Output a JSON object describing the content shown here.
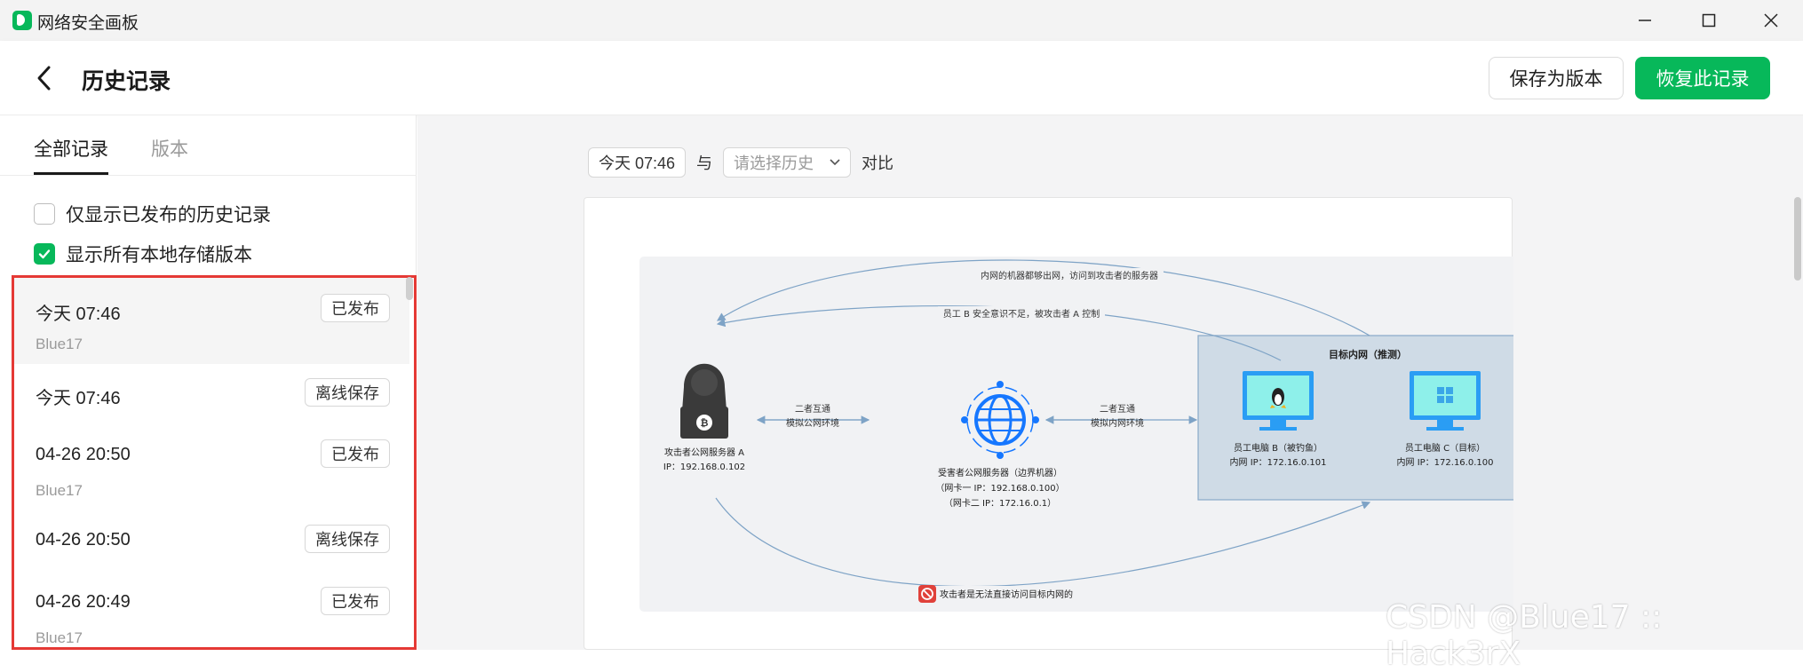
{
  "window": {
    "title": "网络安全画板"
  },
  "header": {
    "title": "历史记录",
    "save_version_label": "保存为版本",
    "restore_label": "恢复此记录"
  },
  "sidebar": {
    "tabs": [
      {
        "label": "全部记录"
      },
      {
        "label": "版本"
      }
    ],
    "filters": [
      {
        "label": "仅显示已发布的历史记录",
        "checked": false
      },
      {
        "label": "显示所有本地存储版本",
        "checked": true
      }
    ],
    "items": [
      {
        "time": "今天 07:46",
        "badge": "已发布",
        "user": "Blue17",
        "selected": true
      },
      {
        "time": "今天 07:46",
        "badge": "离线保存",
        "user": ""
      },
      {
        "time": "04-26 20:50",
        "badge": "已发布",
        "user": "Blue17"
      },
      {
        "time": "04-26 20:50",
        "badge": "离线保存",
        "user": ""
      },
      {
        "time": "04-26 20:49",
        "badge": "已发布",
        "user": "Blue17"
      }
    ]
  },
  "compare": {
    "current": "今天 07:46",
    "with_label": "与",
    "select_placeholder": "请选择历史",
    "action": "对比"
  },
  "diagram": {
    "top_label": "内网的机器都够出网，访问到攻击者的服务器",
    "second_label": "员工 B 安全意识不足，被攻击者 A 控制",
    "target_title": "目标内网（推测）",
    "link1_a": "二者互通",
    "link1_b": "模拟公网环境",
    "link2_a": "二者互通",
    "link2_b": "模拟内网环境",
    "attacker_name": "攻击者公网服务器 A",
    "attacker_ip": "IP：192.168.0.102",
    "victim_name": "受害者公网服务器（边界机器）",
    "victim_nic1": "（网卡一 IP：192.168.0.100）",
    "victim_nic2": "（网卡二 IP：172.16.0.1）",
    "pc_b_name": "员工电脑 B（被钓鱼）",
    "pc_b_ip": "内网 IP：172.16.0.101",
    "pc_c_name": "员工电脑 C（目标）",
    "pc_c_ip": "内网 IP：172.16.0.100",
    "bottom_label": "攻击者是无法直接访问目标内网的"
  },
  "watermark": "CSDN @Blue17 :: Hack3rX",
  "colors": {
    "accent": "#07b85a",
    "highlight": "#e53935",
    "diagram_line": "#7ea3c6",
    "target_fill": "#cfdbe6"
  }
}
